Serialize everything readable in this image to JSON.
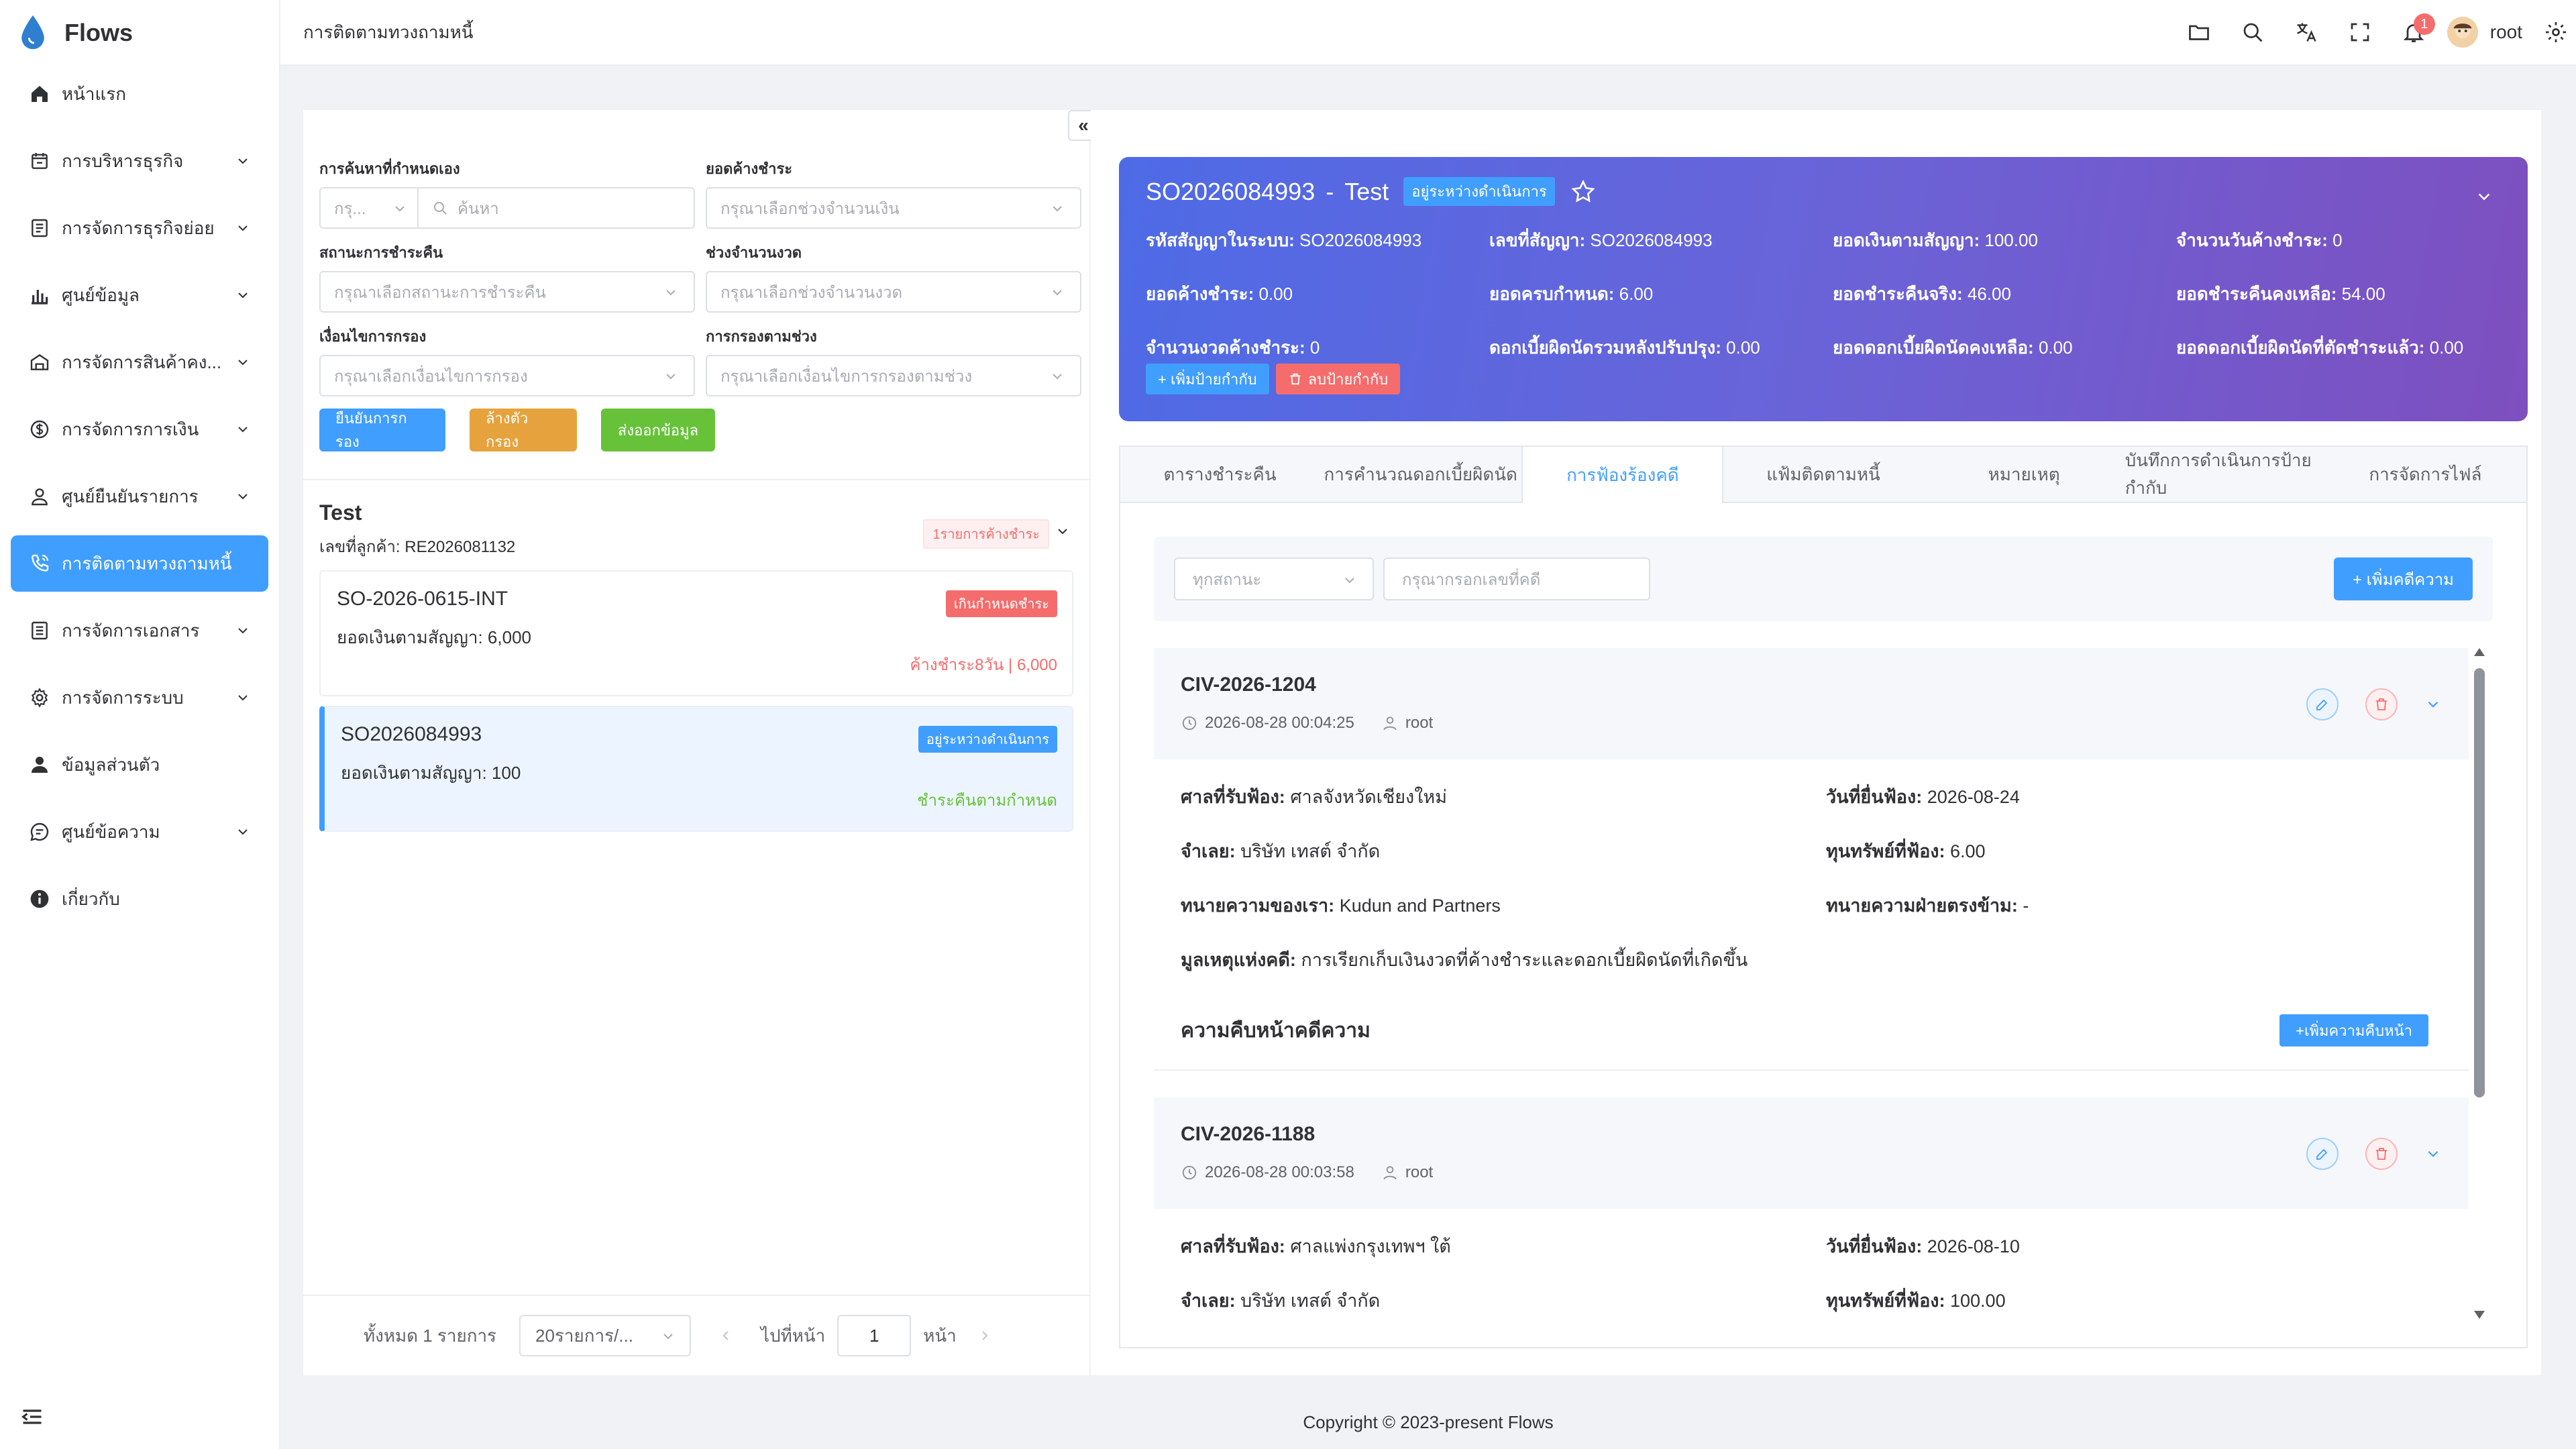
{
  "app": {
    "name": "Flows",
    "brand_color": "#409eff"
  },
  "sidebar": {
    "items": [
      {
        "label": "หน้าแรก",
        "icon": "home-icon",
        "has_children": false,
        "active": false
      },
      {
        "label": "การบริหารธุรกิจ",
        "icon": "calendar-icon",
        "has_children": true,
        "active": false
      },
      {
        "label": "การจัดการธุรกิจย่อย",
        "icon": "document-icon",
        "has_children": true,
        "active": false
      },
      {
        "label": "ศูนย์ข้อมูล",
        "icon": "bar-chart-icon",
        "has_children": true,
        "active": false
      },
      {
        "label": "การจัดการสินค้าคง...",
        "icon": "warehouse-icon",
        "has_children": true,
        "active": false
      },
      {
        "label": "การจัดการการเงิน",
        "icon": "money-icon",
        "has_children": true,
        "active": false
      },
      {
        "label": "ศูนย์ยืนยันรายการ",
        "icon": "user-check-icon",
        "has_children": true,
        "active": false
      },
      {
        "label": "การติดตามทวงถามหนี้",
        "icon": "phone-icon",
        "has_children": false,
        "active": true
      },
      {
        "label": "การจัดการเอกสาร",
        "icon": "file-icon",
        "has_children": true,
        "active": false
      },
      {
        "label": "การจัดการระบบ",
        "icon": "gear-icon",
        "has_children": true,
        "active": false
      },
      {
        "label": "ข้อมูลส่วนตัว",
        "icon": "person-icon",
        "has_children": false,
        "active": false
      },
      {
        "label": "ศูนย์ข้อความ",
        "icon": "message-icon",
        "has_children": true,
        "active": false
      },
      {
        "label": "เกี่ยวกับ",
        "icon": "info-icon",
        "has_children": false,
        "active": false
      }
    ]
  },
  "header": {
    "title": "การติดตามทวงถามหนี้",
    "notification_count": "1",
    "user": "root"
  },
  "filters": {
    "custom_search_label": "การค้นหาที่กำหนดเอง",
    "custom_search_select": "กรุ...",
    "search_placeholder": "ค้นหา",
    "outstanding_label": "ยอดค้างชำระ",
    "outstanding_placeholder": "กรุณาเลือกช่วงจำนวนเงิน",
    "repay_status_label": "สถานะการชำระคืน",
    "repay_status_placeholder": "กรุณาเลือกสถานะการชำระคืน",
    "installment_label": "ช่วงจำนวนงวด",
    "installment_placeholder": "กรุณาเลือกช่วงจำนวนงวด",
    "condition_label": "เงื่อนไขการกรอง",
    "condition_placeholder": "กรุณาเลือกเงื่อนไขการกรอง",
    "range_label": "การกรองตามช่วง",
    "range_placeholder": "กรุณาเลือกเงื่อนไขการกรองตามช่วง",
    "confirm_button": "ยืนยันการกรอง",
    "clear_button": "ล้างตัวกรอง",
    "export_button": "ส่งออกข้อมูล"
  },
  "customer": {
    "name": "Test",
    "number": "เลขที่ลูกค้า: RE2026081132",
    "tag": "1รายการค้างชำระ"
  },
  "contracts": [
    {
      "id": "SO-2026-0615-INT",
      "amount": "ยอดเงินตามสัญญา: 6,000",
      "tag": "เกินกำหนดชำระ",
      "status": "ค้างชำระ8วัน | 6,000"
    },
    {
      "id": "SO2026084993",
      "amount": "ยอดเงินตามสัญญา: 100",
      "tag": "อยู่ระหว่างดำเนินการ",
      "status": "ชำระคืนตามกำหนด"
    }
  ],
  "pager": {
    "total": "ทั้งหมด 1 รายการ",
    "page_size": "20รายการ/...",
    "goto": "ไปที่หน้า",
    "page": "1",
    "page_suffix": "หน้า"
  },
  "hero": {
    "contract_no": "SO2026084993",
    "separator": "-",
    "customer": "Test",
    "status": "อยู่ระหว่างดำเนินการ",
    "fields": [
      {
        "label": "รหัสสัญญาในระบบ:",
        "value": "SO2026084993"
      },
      {
        "label": "เลขที่สัญญา:",
        "value": "SO2026084993"
      },
      {
        "label": "ยอดเงินตามสัญญา:",
        "value": "100.00"
      },
      {
        "label": "จำนวนวันค้างชำระ:",
        "value": "0"
      },
      {
        "label": "ยอดค้างชำระ:",
        "value": "0.00"
      },
      {
        "label": "ยอดครบกำหนด:",
        "value": "6.00"
      },
      {
        "label": "ยอดชำระคืนจริง:",
        "value": "46.00"
      },
      {
        "label": "ยอดชำระคืนคงเหลือ:",
        "value": "54.00"
      },
      {
        "label": "จำนวนงวดค้างชำระ:",
        "value": "0"
      },
      {
        "label": "ดอกเบี้ยผิดนัดรวมหลังปรับปรุง:",
        "value": "0.00"
      },
      {
        "label": "ยอดดอกเบี้ยผิดนัดคงเหลือ:",
        "value": "0.00"
      },
      {
        "label": "ยอดดอกเบี้ยผิดนัดที่ตัดชำระแล้ว:",
        "value": "0.00"
      }
    ],
    "add_tag_button": "+ เพิ่มป้ายกำกับ",
    "remove_tag_button": "ลบป้ายกำกับ"
  },
  "tabs": [
    {
      "label": "ตารางชำระคืน",
      "active": false
    },
    {
      "label": "การคำนวณดอกเบี้ยผิดนัด",
      "active": false
    },
    {
      "label": "การฟ้องร้องคดี",
      "active": true
    },
    {
      "label": "แฟ้มติดตามหนี้",
      "active": false
    },
    {
      "label": "หมายเหตุ",
      "active": false
    },
    {
      "label": "บันทึกการดำเนินการป้ายกำกับ",
      "active": false
    },
    {
      "label": "การจัดการไฟล์",
      "active": false
    }
  ],
  "case_toolbar": {
    "status_select": "ทุกสถานะ",
    "case_no_placeholder": "กรุณากรอกเลขที่คดี",
    "add_case_button": "+ เพิ่มคดีความ"
  },
  "cases": [
    {
      "no": "CIV-2026-1204",
      "time": "2026-08-28 00:04:25",
      "user": "root",
      "court_label": "ศาลที่รับฟ้อง:",
      "court": "ศาลจังหวัดเชียงใหม่",
      "filed_label": "วันที่ยื่นฟ้อง:",
      "filed": "2026-08-24",
      "defendant_label": "จำเลย:",
      "defendant": "บริษัท เทสต์ จำกัด",
      "claim_label": "ทุนทรัพย์ที่ฟ้อง:",
      "claim": "6.00",
      "our_lawyer_label": "ทนายความของเรา:",
      "our_lawyer": "Kudun and Partners",
      "opp_lawyer_label": "ทนายความฝ่ายตรงข้าม:",
      "opp_lawyer": "-",
      "cause_label": "มูลเหตุแห่งคดี:",
      "cause": "การเรียกเก็บเงินงวดที่ค้างชำระและดอกเบี้ยผิดนัดที่เกิดขึ้น",
      "progress_title": "ความคืบหน้าคดีความ",
      "progress_button": "+เพิ่มความคืบหน้า"
    },
    {
      "no": "CIV-2026-1188",
      "time": "2026-08-28 00:03:58",
      "user": "root",
      "court_label": "ศาลที่รับฟ้อง:",
      "court": "ศาลแพ่งกรุงเทพฯ ใต้",
      "filed_label": "วันที่ยื่นฟ้อง:",
      "filed": "2026-08-10",
      "defendant_label": "จำเลย:",
      "defendant": "บริษัท เทสต์ จำกัด",
      "claim_label": "ทุนทรัพย์ที่ฟ้อง:",
      "claim": "100.00"
    }
  ],
  "footer": {
    "copyright": "Copyright © 2023-present Flows"
  }
}
